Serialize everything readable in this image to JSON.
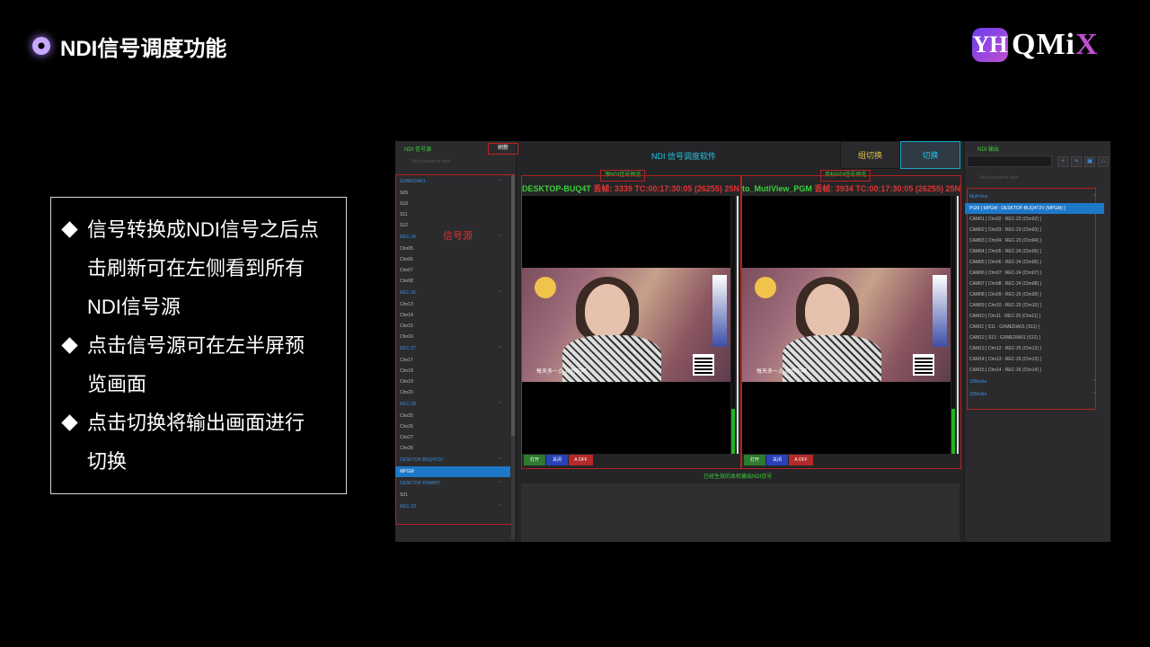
{
  "slide": {
    "title": "NDI信号调度功能",
    "logo": {
      "mark": "YH",
      "name_main": "QMi",
      "name_accent": "X"
    },
    "bullets": [
      "信号转换成NDI信号之后点击刷新可在左侧看到所有NDI信号源",
      "点击信号源可在左半屏预览画面",
      "点击切换将输出画面进行切换"
    ]
  },
  "app": {
    "title": "NDI 信号调度软件",
    "group_switch": "组切换",
    "switch": "切换",
    "left_panel": {
      "header": "NDI 信号源",
      "refresh": "刷新",
      "search_placeholder": "Find keywords here",
      "annotation": "信号源",
      "groups": [
        {
          "name": "GXMEDIA01",
          "items": [
            "S09",
            "S10",
            "S11",
            "S12"
          ]
        },
        {
          "name": "REC-24",
          "items": [
            "Chn05",
            "Chn06",
            "Chn07",
            "Chn08"
          ]
        },
        {
          "name": "REC-26",
          "items": [
            "Chn13",
            "Chn14",
            "Chn15",
            "Chn16"
          ]
        },
        {
          "name": "REC-27",
          "items": [
            "Chn17",
            "Chn18",
            "Chn19",
            "Chn20"
          ]
        },
        {
          "name": "REC-28",
          "items": [
            "Chn25",
            "Chn26",
            "Chn27",
            "Chn28"
          ]
        },
        {
          "name": "DESKTOP-BUQ4T2V",
          "items": [
            "MPGM"
          ]
        },
        {
          "name": "DESKTOP-P3NBH7",
          "items": [
            "S01"
          ]
        },
        {
          "name": "REC-23",
          "items": []
        }
      ]
    },
    "source_preview": {
      "label": "源NDI信号预览",
      "name": "DESKTOP-BUQ4T",
      "status": "丢帧: 3339 TC:00:17:30:05 (26255) 25N",
      "caption": "每天多一点·好好的呵"
    },
    "target_preview": {
      "label": "目标NDI信号预览",
      "name": "to_MutiView_PGM",
      "status": "丢帧: 3934 TC:00:17:30:05 (26255) 25N",
      "caption": "每天多一点·好好的呵"
    },
    "preview_buttons": {
      "open": "打开",
      "close": "关闭",
      "aoff": "A OFF"
    },
    "output_label": "已经生效的本机输出NDI信号",
    "right_panel": {
      "header": "NDI 输出",
      "search_placeholder": "Find keywords here",
      "groups": [
        {
          "name": "MutiView",
          "items": [
            "PGM [ MPGM : DESKTOP-BUQ4T2V (MPGM) ]",
            "CAM01 [ Chn02 : REC-23 (Chn02) ]",
            "CAM02 [ Chn03 : REC-23 (Chn03) ]",
            "CAM03 [ Chn04 : REC-23 (Chn04) ]",
            "CAM04 [ Chn05 : REC-24 (Chn05) ]",
            "CAM05 [ Chn06 : REC-24 (Chn06) ]",
            "CAM06 [ Chn07 : REC-24 (Chn07) ]",
            "CAM07 [ Chn08 : REC-24 (Chn08) ]",
            "CAM08 [ Chn09 : REC-25 (Chn09) ]",
            "CAM09 [ Chn10 : REC-25 (Chn10) ]",
            "CAM10 [ Chn11 : REC-25 (Chn11) ]",
            "CAM11 [ S11 : GXMEDIA01 (S11) ]",
            "CAM12 [ S12 : GXMEDIA01 (S12) ]",
            "CAM13 [ Chn12 : REC-25 (Chn12) ]",
            "CAM14 [ Chn13 : REC-26 (Chn13) ]",
            "CAM15 [ Chn14 : REC-26 (Chn14) ]"
          ]
        },
        {
          "name": "10Media",
          "items": []
        },
        {
          "name": "20Media",
          "items": []
        }
      ]
    }
  }
}
